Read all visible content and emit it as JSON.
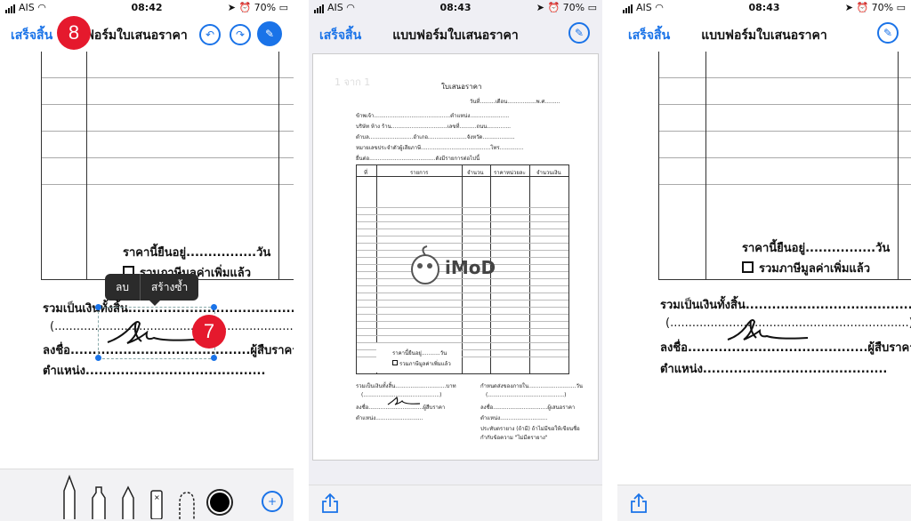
{
  "status": {
    "carrier": "AIS",
    "battery": "70%",
    "time_left": "08:42",
    "time_middle": "08:43",
    "time_right": "08:43"
  },
  "panel1": {
    "done_label": "เสร็จสิ้น",
    "title": "แบบฟอร์มใบเสนอราคา",
    "title_visible": "ฟอร์มใบเสนอราคา",
    "badge_left": "8",
    "badge_sig": "7",
    "popup": {
      "delete": "ลบ",
      "duplicate": "สร้างซ้ำ"
    },
    "price_valid": "ราคานี้ยืนอยู่................วัน",
    "vat_text": "รวมภาษีมูลค่าเพิ่มแล้ว",
    "total_line": "รวมเป็นเงินทั้งสิ้น........................................บาท",
    "paren_line": "(.................................................................)",
    "sign_line": "ลงชื่อ.........................................ผู้สืบราคา",
    "position_line": "ตำแหน่ง.........................................",
    "tools": [
      "pen-icon",
      "marker-icon",
      "pencil-icon",
      "eraser-icon",
      "lasso-icon",
      "color-icon",
      "add-icon"
    ]
  },
  "panel2": {
    "done_label": "เสร็จสิ้น",
    "title": "แบบฟอร์มใบเสนอราคา",
    "page_indicator": "1 จาก 1",
    "doc_title": "ใบเสนอราคา",
    "date_line": "วันที่.........เดือน.................พ.ศ.........",
    "lines": [
      "ข้าพเจ้า.............................................ตำแหน่ง.......................",
      "บริษัท ห้าง ร้าน.................................เลขที่..........ถนน..............",
      "ตำบล..........................อำเภอ.......................จังหวัด...................",
      "หมายเลขประจำตัวผู้เสียภาษี.........................................โทร..............",
      "ยื่นต่อ.......................................ดังมีรายการต่อไปนี้"
    ],
    "table_headers": [
      "ที่",
      "รายการ",
      "จำนวน",
      "ราคาหน่วยละ",
      "จำนวนเงิน"
    ],
    "watermark": "iMoD",
    "price_valid": "ราคานี้ยืนอยู่...........วัน",
    "vat_text": "รวมภาษีมูลค่าเพิ่มแล้ว",
    "left_block": [
      "รวมเป็นเงินทั้งสิ้น..............................บาท",
      "(.............................................)",
      "ลงชื่อ................................ผู้สืบราคา",
      "ตำแหน่ง............................"
    ],
    "right_block": [
      "กำหนดส่งของภายใน............................วัน",
      "(.............................................)",
      "ลงชื่อ................................ผู้เสนอราคา",
      "ตำแหน่ง............................",
      "ประทับตรายาง (ถ้ามี) ถ้าไม่มีขอให้เขียนชื่อ",
      "กำกับข้อความ \"ไม่มีตรายาง\""
    ]
  },
  "panel3": {
    "done_label": "เสร็จสิ้น",
    "title": "แบบฟอร์มใบเสนอราคา",
    "price_valid": "ราคานี้ยืนอยู่................วัน",
    "vat_text": "รวมภาษีมูลค่าเพิ่มแล้ว",
    "total_line": "รวมเป็นเงินทั้งสิ้น........................................บาท",
    "paren_line": "(.................................................................)",
    "sign_line": "ลงชื่อ.........................................ผู้สืบราคา",
    "position_line": "ตำแหน่ง.........................................."
  },
  "colors": {
    "accent": "#1a73e8",
    "badge": "#e5192d"
  }
}
